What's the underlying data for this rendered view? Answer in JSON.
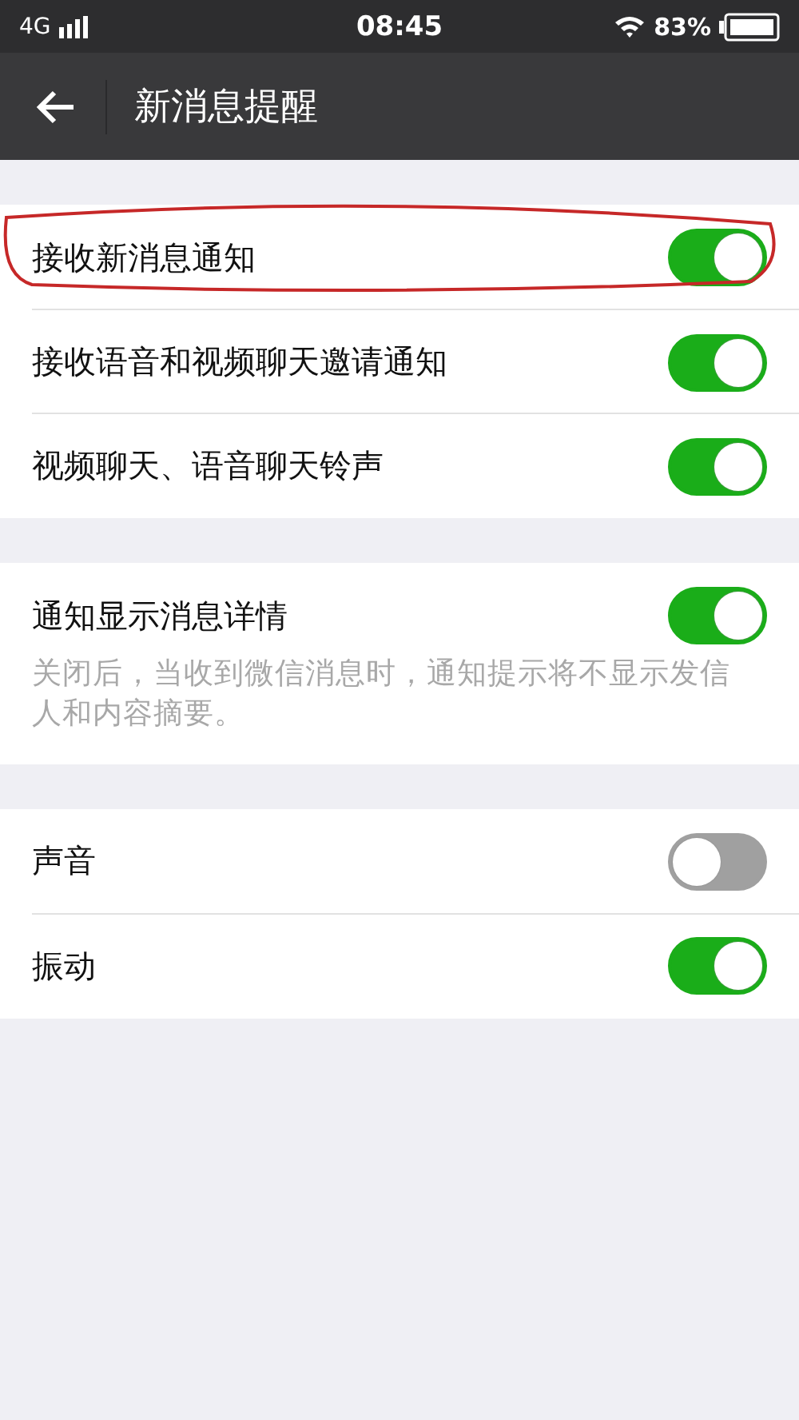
{
  "status_bar": {
    "network": "4G",
    "time": "08:45",
    "battery": "83%"
  },
  "header": {
    "title": "新消息提醒"
  },
  "groups": [
    {
      "items": [
        {
          "label": "接收新消息通知",
          "on": true,
          "circled": true
        },
        {
          "label": "接收语音和视频聊天邀请通知",
          "on": true
        },
        {
          "label": "视频聊天、语音聊天铃声",
          "on": true
        }
      ]
    },
    {
      "items": [
        {
          "label": "通知显示消息详情",
          "on": true,
          "description": "关闭后，当收到微信消息时，通知提示将不显示发信人和内容摘要。"
        }
      ]
    },
    {
      "items": [
        {
          "label": "声音",
          "on": false
        },
        {
          "label": "振动",
          "on": true
        }
      ]
    }
  ]
}
